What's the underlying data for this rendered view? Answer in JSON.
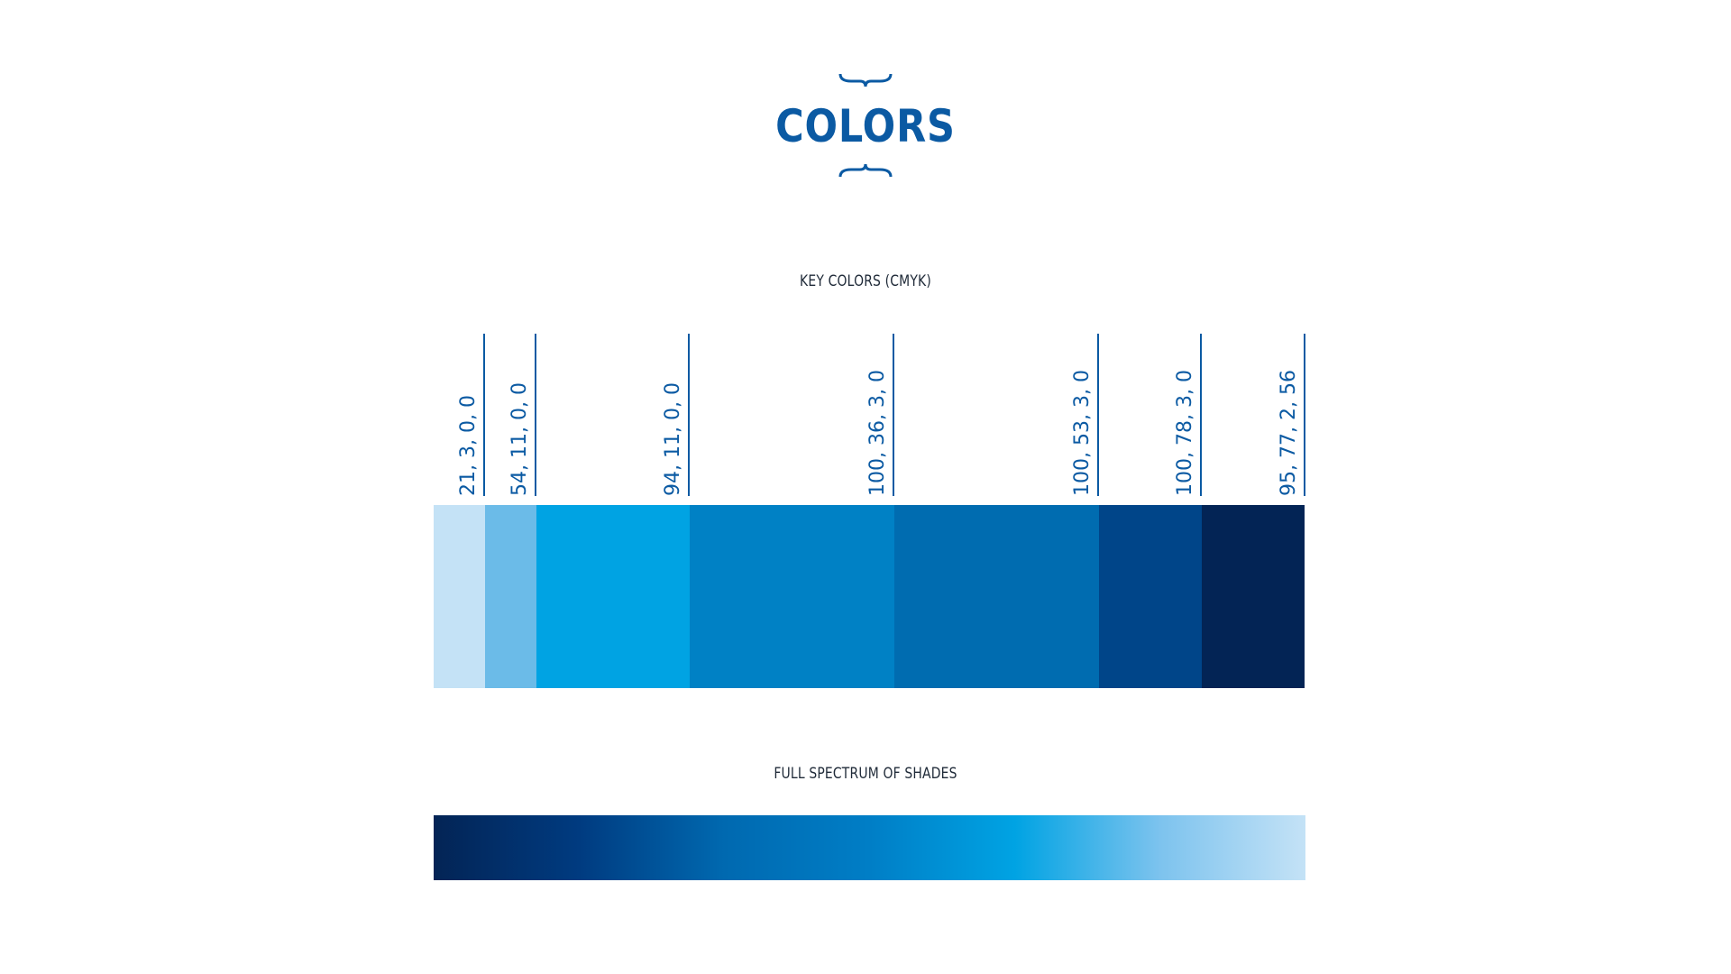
{
  "title": "COLORS",
  "key_colors_label": "KEY COLORS (CMYK)",
  "spectrum_label": "FULL SPECTRUM OF SHADES",
  "key_colors": [
    {
      "cmyk": "21, 3, 0, 0",
      "hex": "#c4e2f6",
      "share": 0.059
    },
    {
      "cmyk": "54, 11, 0, 0",
      "hex": "#6bbbe8",
      "share": 0.059
    },
    {
      "cmyk": "94, 11, 0, 0",
      "hex": "#00a3e3",
      "share": 0.176
    },
    {
      "cmyk": "100, 36, 3, 0",
      "hex": "#0081c5",
      "share": 0.235
    },
    {
      "cmyk": "100, 53, 3, 0",
      "hex": "#006cb0",
      "share": 0.235
    },
    {
      "cmyk": "100, 78, 3, 0",
      "hex": "#004589",
      "share": 0.118
    },
    {
      "cmyk": "95, 77, 2, 56",
      "hex": "#032455",
      "share": 0.118
    }
  ],
  "spectrum_colors": [
    "#032455",
    "#003b80",
    "#0069b0",
    "#007ec6",
    "#00a3e3",
    "#7dc3ee",
    "#c4e2f6"
  ],
  "accent_color": "#0b5aa3"
}
